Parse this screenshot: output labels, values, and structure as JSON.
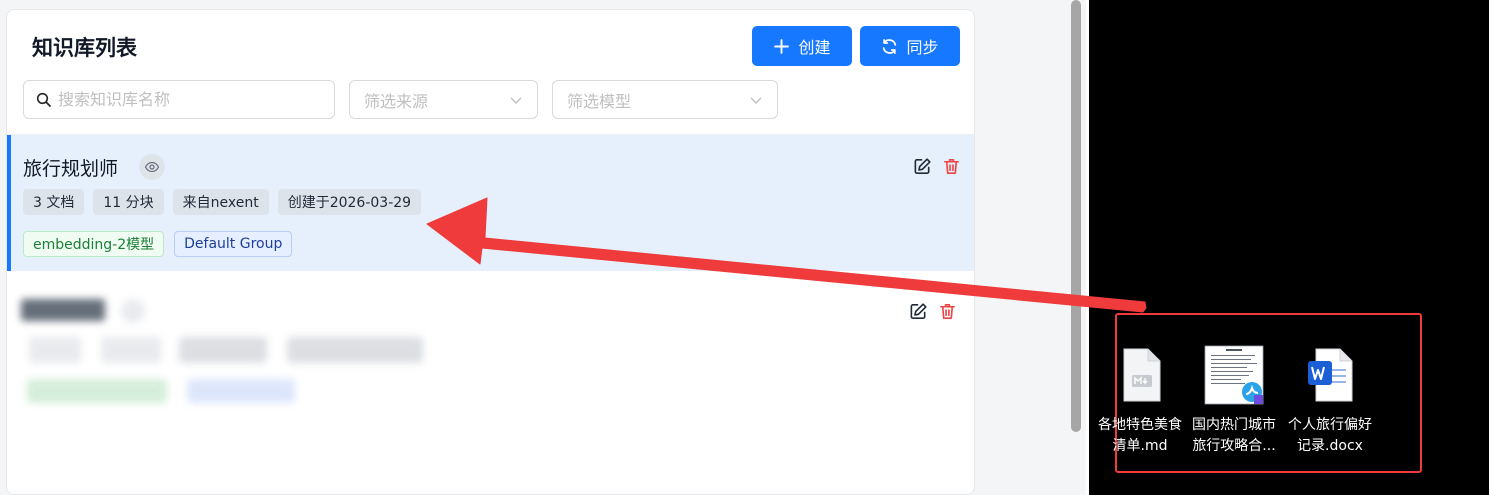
{
  "panel": {
    "title": "知识库列表",
    "create_label": "创建",
    "sync_label": "同步",
    "search_placeholder": "搜索知识库名称",
    "filter_source_placeholder": "筛选来源",
    "filter_model_placeholder": "筛选模型"
  },
  "knowledge_bases": [
    {
      "name": "旅行规划师",
      "docs": "3 文档",
      "chunks": "11 分块",
      "source": "来自nexent",
      "created": "创建于2026-03-29",
      "model": "embedding-2模型",
      "group": "Default Group"
    }
  ],
  "desktop": {
    "files": [
      {
        "name_line1": "各地特色美食",
        "name_line2": "清单.md",
        "icon": "markdown-file-icon"
      },
      {
        "name_line1": "国内热门城市",
        "name_line2": "旅行攻略合...",
        "icon": "pdf-file-icon"
      },
      {
        "name_line1": "个人旅行偏好",
        "name_line2": "记录.docx",
        "icon": "word-file-icon"
      }
    ]
  },
  "colors": {
    "primary": "#1677ff",
    "danger": "#ef4444",
    "annotation": "#ef3b3b",
    "active_card_bg": "#e6f0fc"
  }
}
